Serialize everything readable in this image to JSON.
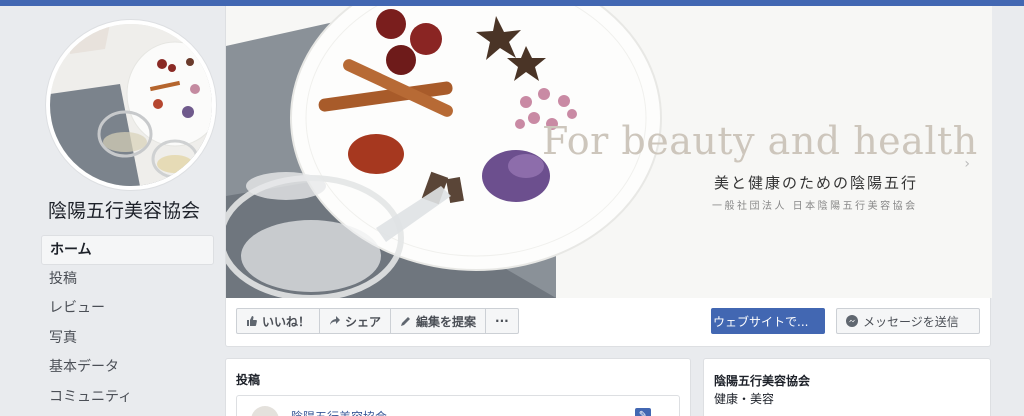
{
  "page": {
    "name": "陰陽五行美容協会"
  },
  "nav": {
    "items": [
      {
        "label": "ホーム"
      },
      {
        "label": "投稿"
      },
      {
        "label": "レビュー"
      },
      {
        "label": "写真"
      },
      {
        "label": "基本データ"
      },
      {
        "label": "コミュニティ"
      }
    ]
  },
  "cover": {
    "english": "For beauty and health",
    "japanese": "美と健康のための陰陽五行",
    "subtitle": "一般社団法人 日本陰陽五行美容協会",
    "arrow": "›"
  },
  "actions": {
    "like": "いいね！",
    "share": "シェア",
    "suggest_edit": "編集を提案",
    "more": "···",
    "website": "ウェブサイトで...",
    "message": "メッセージを送信"
  },
  "posts": {
    "title": "投稿",
    "composer_name": "陰陽五行美容協会"
  },
  "about": {
    "name": "陰陽五行美容協会",
    "category": "健康・美容"
  },
  "colors": {
    "brand": "#4267b2",
    "background": "#e9ebee",
    "link": "#385898"
  }
}
